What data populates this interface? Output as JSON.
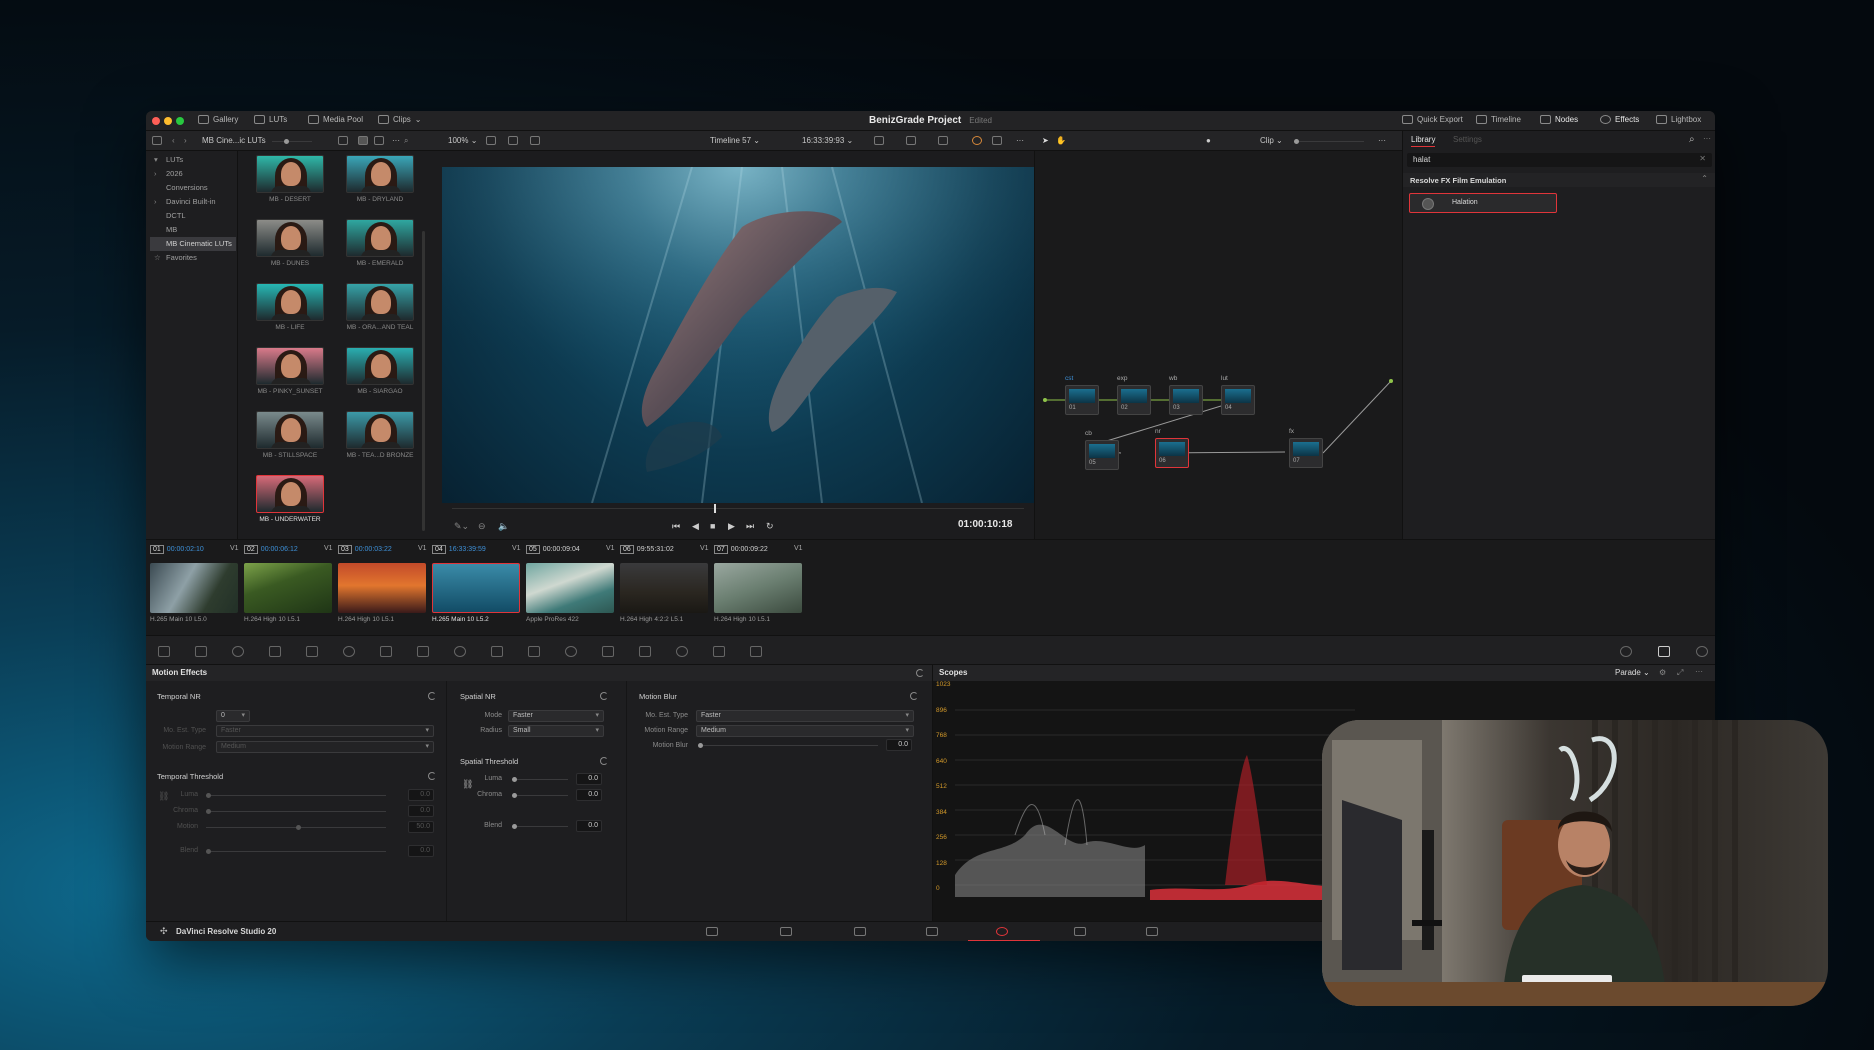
{
  "window": {
    "title": "BenizGrade Project",
    "status": "Edited"
  },
  "titlebar": {
    "left": [
      {
        "label": "Gallery",
        "icon": "gallery-icon"
      },
      {
        "label": "LUTs",
        "icon": "luts-icon"
      },
      {
        "label": "Media Pool",
        "icon": "media-pool-icon"
      },
      {
        "label": "Clips",
        "icon": "clips-icon"
      }
    ],
    "right": [
      {
        "label": "Quick Export",
        "icon": "export-icon"
      },
      {
        "label": "Timeline",
        "icon": "timeline-icon"
      },
      {
        "label": "Nodes",
        "icon": "nodes-icon"
      },
      {
        "label": "Effects",
        "icon": "fx-icon"
      },
      {
        "label": "Lightbox",
        "icon": "lightbox-icon"
      }
    ]
  },
  "toolbar": {
    "folder": "MB Cine...ic LUTs",
    "zoom": "100%",
    "timeline": "Timeline 57",
    "timecode": "16:33:39:93",
    "node_mode": "Clip"
  },
  "sidebar": {
    "items": [
      {
        "label": "LUTs",
        "expand": "▾"
      },
      {
        "label": "2026",
        "expand": "›"
      },
      {
        "label": "Conversions",
        "expand": ""
      },
      {
        "label": "Davinci Built-in",
        "expand": "›"
      },
      {
        "label": "DCTL",
        "expand": ""
      },
      {
        "label": "MB",
        "expand": ""
      },
      {
        "label": "MB Cinematic LUTs",
        "expand": ""
      },
      {
        "label": "Favorites",
        "expand": "☆"
      }
    ],
    "selected_index": 6
  },
  "luts": [
    {
      "label": "MB - DESERT",
      "tint": "#2fb8a8"
    },
    {
      "label": "MB - DRYLAND",
      "tint": "#3aa6b8"
    },
    {
      "label": "MB - DUNES",
      "tint": "#8c8c88"
    },
    {
      "label": "MB - EMERALD",
      "tint": "#2fa7a0"
    },
    {
      "label": "MB - LIFE",
      "tint": "#27b7b4"
    },
    {
      "label": "MB - ORA...AND TEAL",
      "tint": "#36a3a8"
    },
    {
      "label": "MB - PINKY_SUNSET",
      "tint": "#d97a8a"
    },
    {
      "label": "MB - SIARGAO",
      "tint": "#2aaeb0"
    },
    {
      "label": "MB - STILLSPACE",
      "tint": "#7a8a8c"
    },
    {
      "label": "MB - TEA...D BRONZE",
      "tint": "#3c9aa8"
    },
    {
      "label": "MB - UNDERWATER",
      "tint": "#d66a78"
    }
  ],
  "viewer": {
    "timecode": "01:00:10:18"
  },
  "nodes": [
    {
      "label": "cst",
      "num": "01"
    },
    {
      "label": "exp",
      "num": "02"
    },
    {
      "label": "wb",
      "num": "03"
    },
    {
      "label": "lut",
      "num": "04"
    },
    {
      "label": "cb",
      "num": "05"
    },
    {
      "label": "nr",
      "num": "06"
    },
    {
      "label": "fx",
      "num": "07"
    }
  ],
  "library": {
    "tabs": [
      "Library",
      "Settings"
    ],
    "search": "halat",
    "category": "Resolve FX Film Emulation",
    "result": "Halation"
  },
  "clips": [
    {
      "num": "01",
      "tc": "00:00:02:10",
      "track": "V1",
      "codec": "H.265 Main 10 L5.0",
      "bg": "linear-gradient(120deg,#3b4a52 0%,#8ea0a6 40%,#2e3c2e 70%,#223027 100%)"
    },
    {
      "num": "02",
      "tc": "00:00:06:12",
      "track": "V1",
      "codec": "H.264 High 10 L5.1",
      "bg": "linear-gradient(160deg,#7da34a 0%,#3a5a22 40%,#1f3516 100%)"
    },
    {
      "num": "03",
      "tc": "00:00:03:22",
      "track": "V1",
      "codec": "H.264 High 10 L5.1",
      "bg": "linear-gradient(180deg,#c24a2a 0%,#e2762e 45%,#3a1a1a 100%)"
    },
    {
      "num": "04",
      "tc": "16:33:39:59",
      "track": "V1",
      "codec": "H.265 Main 10 L5.2",
      "bg": "linear-gradient(180deg,#3a8ba8 0%,#124c66 100%)"
    },
    {
      "num": "05",
      "tc": "00:00:09:04",
      "track": "V1",
      "codec": "Apple ProRes 422",
      "bg": "linear-gradient(160deg,#6fa6a0 0%,#cfd8d0 40%,#3f7a78 70%,#2d5752 100%)"
    },
    {
      "num": "06",
      "tc": "09:55:31:02",
      "track": "V1",
      "codec": "H.264 High 4:2:2 L5.1",
      "bg": "linear-gradient(180deg,#3a3a3c 0%,#2a2620 60%,#1a1814 100%)"
    },
    {
      "num": "07",
      "tc": "00:00:09:22",
      "track": "V1",
      "codec": "H.264 High 10 L5.1",
      "bg": "linear-gradient(160deg,#9aa8a0 0%,#6a7e70 50%,#3b4a3e 100%)"
    }
  ],
  "motion": {
    "title": "Motion Effects",
    "temporal_nr": {
      "title": "Temporal NR",
      "frames_value": "0",
      "est_type_label": "Mo. Est. Type",
      "est_type_value": "Faster",
      "range_label": "Motion Range",
      "range_value": "Medium"
    },
    "temporal_threshold": {
      "title": "Temporal Threshold",
      "rows": [
        {
          "label": "Luma",
          "value": "0.0",
          "pct": 0
        },
        {
          "label": "Chroma",
          "value": "0.0",
          "pct": 0
        },
        {
          "label": "Motion",
          "value": "50.0",
          "pct": 0.5
        },
        {
          "label": "Blend",
          "value": "0.0",
          "pct": 0
        }
      ]
    },
    "spatial_nr": {
      "title": "Spatial NR",
      "mode_label": "Mode",
      "mode_value": "Faster",
      "radius_label": "Radius",
      "radius_value": "Small"
    },
    "spatial_threshold": {
      "title": "Spatial Threshold",
      "rows": [
        {
          "label": "Luma",
          "value": "0.0",
          "pct": 0
        },
        {
          "label": "Chroma",
          "value": "0.0",
          "pct": 0
        }
      ],
      "blend_label": "Blend",
      "blend_value": "0.0"
    },
    "motion_blur": {
      "title": "Motion Blur",
      "est_type_label": "Mo. Est. Type",
      "est_type_value": "Faster",
      "range_label": "Motion Range",
      "range_value": "Medium",
      "blur_label": "Motion Blur",
      "blur_value": "0.0"
    }
  },
  "scopes": {
    "title": "Scopes",
    "mode": "Parade",
    "scale": [
      "1023",
      "896",
      "768",
      "640",
      "512",
      "384",
      "256",
      "128",
      "0"
    ]
  },
  "status_bar": {
    "app": "DaVinci Resolve Studio 20"
  },
  "colors": {
    "accent_red": "#e0353a",
    "accent_blue": "#3d8fd6",
    "scope_scale": "#d49a2a"
  }
}
